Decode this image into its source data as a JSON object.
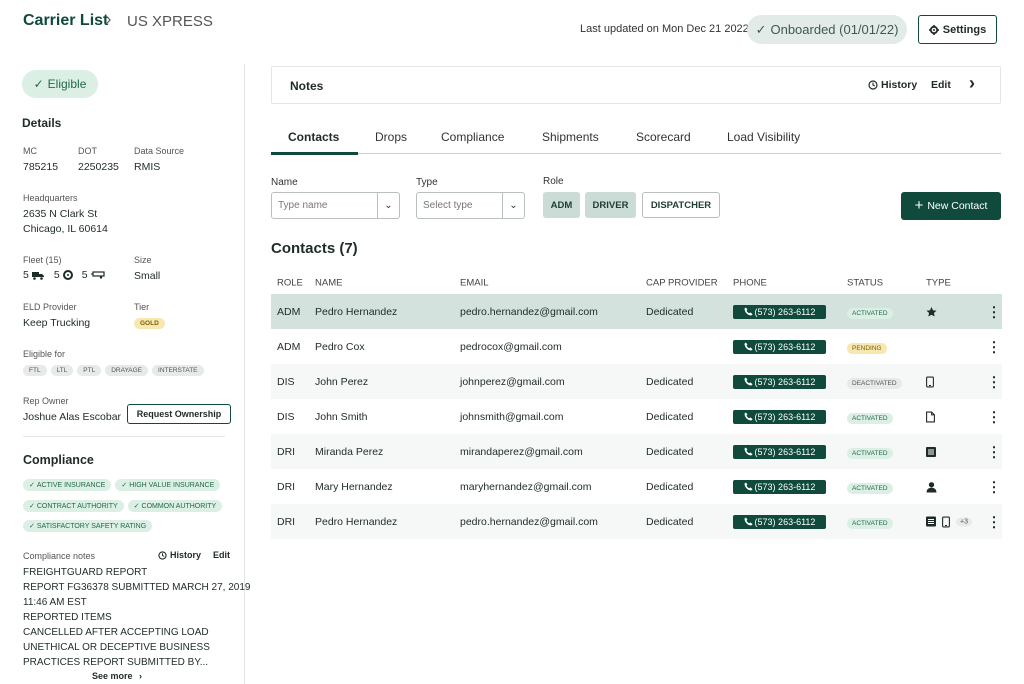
{
  "header": {
    "breadcrumb_root": "Carrier List",
    "breadcrumb_sep": "›",
    "breadcrumb_leaf": "US XPRESS",
    "last_updated": "Last updated on Mon Dec 21 2022",
    "onboarded": "Onboarded (01/01/22)",
    "settings_label": "Settings"
  },
  "sidebar": {
    "eligible": "Eligible",
    "details_title": "Details",
    "mc_label": "MC",
    "mc_value": "785215",
    "dot_label": "DOT",
    "dot_value": "2250235",
    "source_label": "Data Source",
    "source_value": "RMIS",
    "hq_label": "Headquarters",
    "hq_line1": "2635 N Clark St",
    "hq_line2": "Chicago, IL 60614",
    "fleet_label": "Fleet (15)",
    "fleet_counts": [
      "5",
      "5",
      "5"
    ],
    "size_label": "Size",
    "size_value": "Small",
    "eld_label": "ELD Provider",
    "eld_value": "Keep Trucking",
    "tier_label": "Tier",
    "tier_value": "GOLD",
    "eligible_for_label": "Eligible for",
    "eligible_for": [
      "FTL",
      "LTL",
      "PTL",
      "DRAYAGE",
      "INTERSTATE"
    ],
    "rep_label": "Rep Owner",
    "rep_value": "Joshue Alas Escobar",
    "request_btn": "Request Ownership",
    "compliance_title": "Compliance",
    "compliance_pills": [
      "ACTIVE INSURANCE",
      "HIGH VALUE INSURANCE",
      "CONTRACT AUTHORITY",
      "COMMON AUTHORITY",
      "SATISFACTORY SAFETY RATING"
    ],
    "compliance_notes_label": "Compliance notes",
    "history_label": "History",
    "edit_label": "Edit",
    "notes_lines": [
      "FREIGHTGUARD REPORT",
      "REPORT FG36378 SUBMITTED MARCH 27, 2019",
      "11:46 AM EST",
      "REPORTED ITEMS",
      "CANCELLED AFTER ACCEPTING LOAD",
      "UNETHICAL OR DECEPTIVE BUSINESS",
      "PRACTICES REPORT SUBMITTED BY..."
    ],
    "see_more": "See more"
  },
  "notes_panel": {
    "title": "Notes",
    "history": "History",
    "edit": "Edit"
  },
  "tabs": [
    "Contacts",
    "Drops",
    "Compliance",
    "Shipments",
    "Scorecard",
    "Load Visibility"
  ],
  "filters": {
    "name_label": "Name",
    "name_placeholder": "Type name",
    "type_label": "Type",
    "type_placeholder": "Select type",
    "role_label": "Role",
    "roles": [
      "ADM",
      "DRIVER",
      "DISPATCHER"
    ],
    "new_contact": "New Contact"
  },
  "contacts": {
    "heading": "Contacts (7)",
    "columns": [
      "ROLE",
      "NAME",
      "EMAIL",
      "CAP PROVIDER",
      "PHONE",
      "STATUS",
      "TYPE"
    ],
    "rows": [
      {
        "role": "ADM",
        "name": "Pedro Hernandez",
        "email": "pedro.hernandez@gmail.com",
        "cap": "Dedicated",
        "phone": "(573) 263-6112",
        "status": "ACTIVATED",
        "types": [
          "star"
        ],
        "extra": ""
      },
      {
        "role": "ADM",
        "name": "Pedro Cox",
        "email": "pedrocox@gmail.com",
        "cap": "",
        "phone": "(573) 263-6112",
        "status": "PENDING",
        "types": [],
        "extra": ""
      },
      {
        "role": "DIS",
        "name": "John Perez",
        "email": "johnperez@gmail.com",
        "cap": "Dedicated",
        "phone": "(573) 263-6112",
        "status": "DEACTIVATED",
        "types": [
          "mobile"
        ],
        "extra": ""
      },
      {
        "role": "DIS",
        "name": "John Smith",
        "email": "johnsmith@gmail.com",
        "cap": "Dedicated",
        "phone": "(573) 263-6112",
        "status": "ACTIVATED",
        "types": [
          "document"
        ],
        "extra": ""
      },
      {
        "role": "DRI",
        "name": "Miranda Perez",
        "email": "mirandaperez@gmail.com",
        "cap": "Dedicated",
        "phone": "(573) 263-6112",
        "status": "ACTIVATED",
        "types": [
          "list"
        ],
        "extra": ""
      },
      {
        "role": "DRI",
        "name": "Mary Hernandez",
        "email": "maryhernandez@gmail.com",
        "cap": "Dedicated",
        "phone": "(573) 263-6112",
        "status": "ACTIVATED",
        "types": [
          "person"
        ],
        "extra": ""
      },
      {
        "role": "DRI",
        "name": "Pedro Hernandez",
        "email": "pedro.hernandez@gmail.com",
        "cap": "Dedicated",
        "phone": "(573) 263-6112",
        "status": "ACTIVATED",
        "types": [
          "list",
          "mobile"
        ],
        "extra": "+3"
      }
    ]
  }
}
